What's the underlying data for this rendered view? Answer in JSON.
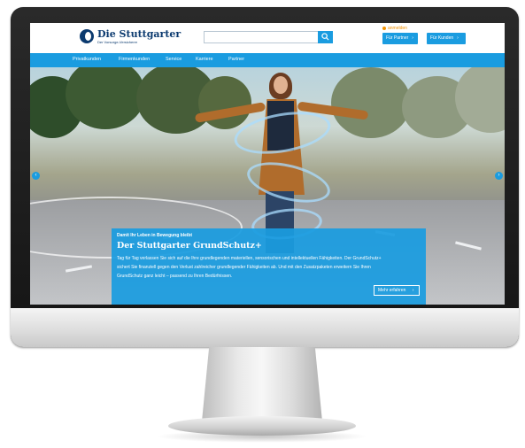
{
  "header": {
    "logo_name": "Die Stuttgarter",
    "logo_tagline": "Der Vorsorge-Versicherer",
    "search_placeholder": "",
    "login_label": "anmelden",
    "partner_button": "Für Partner",
    "kunden_button": "Für Kunden",
    "chevron": "›"
  },
  "nav": {
    "items": [
      "Privatkunden",
      "Firmenkunden",
      "Service",
      "Karriere",
      "Partner"
    ]
  },
  "hero": {
    "eyebrow": "Damit Ihr Leben in Bewegung bleibt",
    "title": "Der Stuttgarter GrundSchutz+",
    "body": "Tag für Tag verlassen Sie sich auf die Ihre grundlegenden materiellen, sensorischen und intellektuellen Fähigkeiten. Der GrundSchutz+ sichert Sie finanziell gegen den Verlust zahlreicher grundlegender Fähigkeiten ab. Und mit den Zusatzpaketen erweitern Sie Ihren GrundSchutz ganz leicht – passend zu Ihren Bedürfnissen.",
    "cta": "Mehr erfahren",
    "arrow_left": "‹",
    "arrow_right": "›"
  },
  "colors": {
    "brand_blue": "#1a9ce0",
    "logo_navy": "#0b3a6f",
    "login_orange": "#f39200"
  },
  "icons": [
    "search-icon",
    "user-icon",
    "chevron-right-icon",
    "arrow-left-icon",
    "arrow-right-icon",
    "logo-icon"
  ]
}
